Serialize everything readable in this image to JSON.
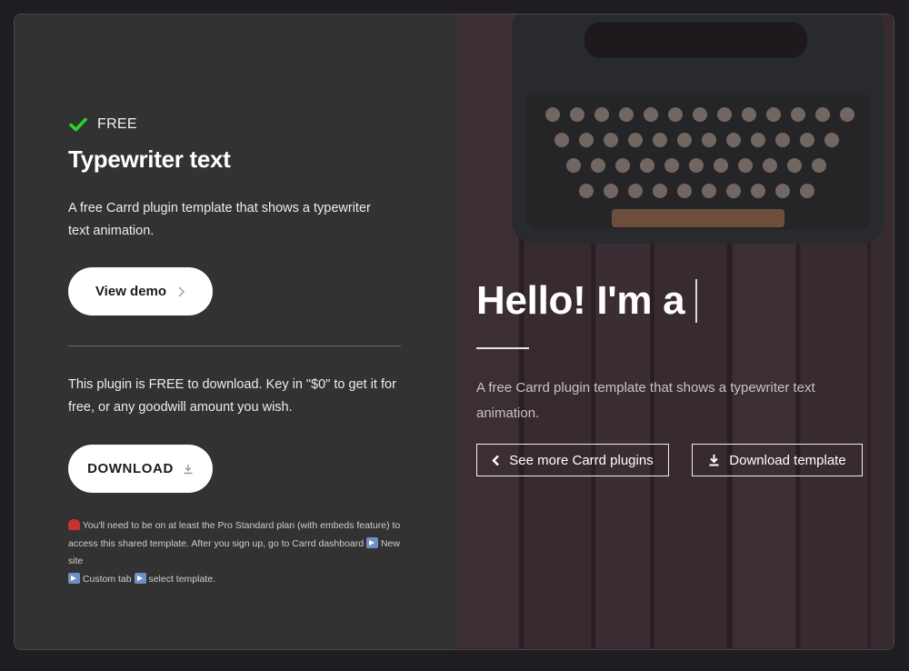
{
  "left": {
    "badge": "FREE",
    "title": "Typewriter text",
    "description": "A free Carrd plugin template that shows a typewriter text animation.",
    "view_demo_label": "View demo",
    "plugin_note": "This plugin is FREE to download. Key in \"$0\" to get it for free, or any goodwill amount you wish.",
    "download_label": "DOWNLOAD",
    "fine_print": {
      "part1": " You'll need to be on at least the Pro Standard plan (with embeds feature) to access this shared template. After you sign up, go to Carrd dashboard ",
      "part2": " New site ",
      "part3": " Custom tab ",
      "part4": " select template."
    }
  },
  "right": {
    "hero_title": "Hello! I'm a",
    "hero_description": "A free Carrd plugin template that shows a typewriter text animation.",
    "more_plugins_label": "See more Carrd plugins",
    "download_template_label": "Download template"
  },
  "colors": {
    "left_bg": "#333233",
    "check_green": "#2bd12b",
    "button_bg": "#ffffff",
    "overlay": "#3a3235"
  },
  "icons": [
    "check-icon",
    "chevron-right-icon",
    "download-icon",
    "chevron-left-icon",
    "siren-emoji",
    "right-arrow-emoji"
  ]
}
